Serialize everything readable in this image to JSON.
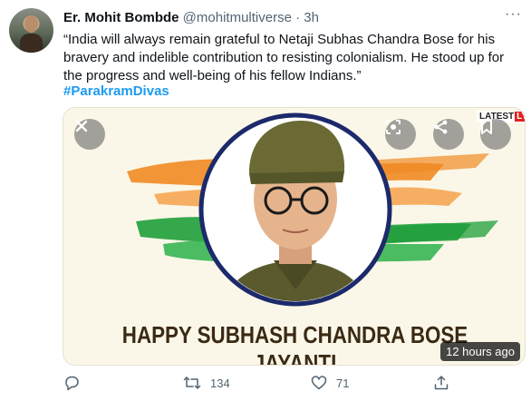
{
  "author": {
    "name": "Er. Mohit Bombde",
    "handle": "@mohitmultiverse",
    "separator": "·",
    "time": "3h"
  },
  "tweet": {
    "text": "“India will always remain grateful to Netaji Subhas Chandra Bose for his bravery and indelible contribution to resisting colonialism. He stood up for the progress and well-being of his fellow Indians.”",
    "hashtag": "#ParakramDivas"
  },
  "media": {
    "banner_text": "HAPPY SUBHASH CHANDRA BOSE JAYANTI",
    "logo_text": "LATEST",
    "logo_badge": "LY",
    "timestamp": "12 hours ago",
    "icons": [
      "close-icon",
      "lens-icon",
      "share-icon",
      "bookmark-icon"
    ]
  },
  "actions": {
    "reply_count": "",
    "retweet_count": "134",
    "like_count": "71"
  },
  "colors": {
    "link": "#1d9bf0",
    "muted": "#536471",
    "saffron": "#f08a24",
    "green": "#1f9e3a",
    "navy": "#1c2a6b"
  }
}
